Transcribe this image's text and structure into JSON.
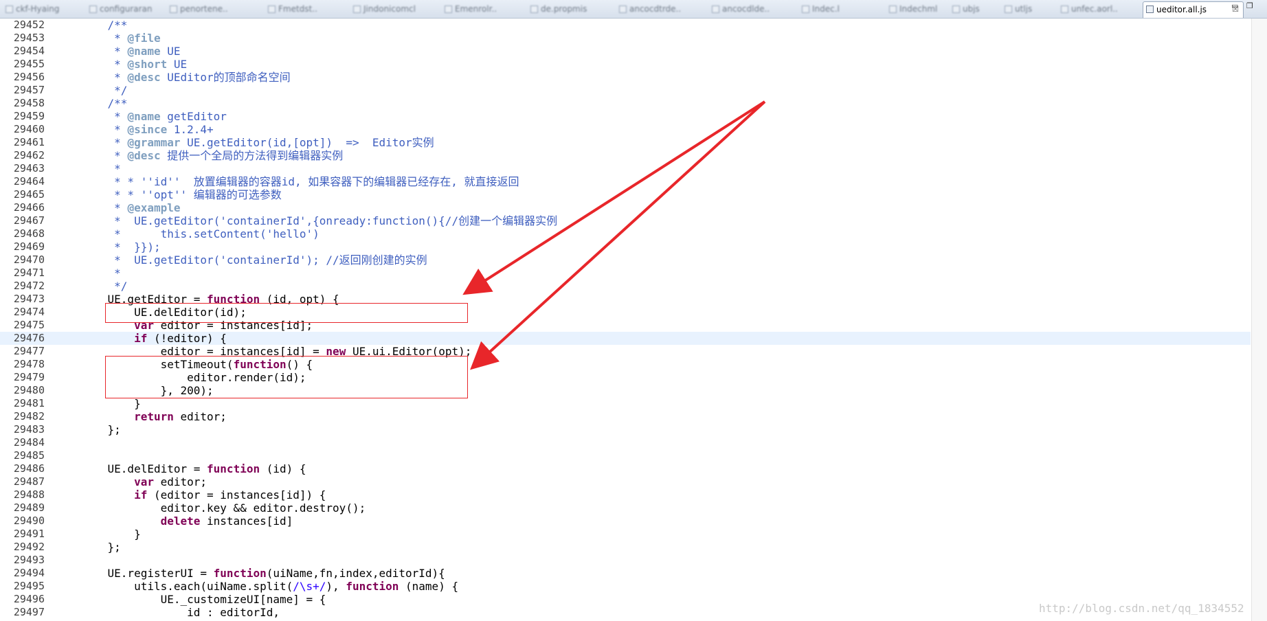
{
  "tabs": [
    {
      "label": "ckf-Hyaing"
    },
    {
      "label": "configuraran"
    },
    {
      "label": "penortene.."
    },
    {
      "label": "Fmetdst.."
    },
    {
      "label": "Jindonicomcl"
    },
    {
      "label": "Emenrolr.."
    },
    {
      "label": "de.propmis"
    },
    {
      "label": "ancocdtrde.."
    },
    {
      "label": "ancocdlde.."
    },
    {
      "label": "Indec.l"
    },
    {
      "label": "Indechml"
    },
    {
      "label": "ubjs"
    },
    {
      "label": "utljs"
    },
    {
      "label": "unfec.aorl.."
    },
    {
      "label": "ueditor.all.js",
      "active": true
    }
  ],
  "active_tab_close": "☒",
  "window_controls": {
    "minimize": "▭",
    "maximize": "❐"
  },
  "highlighted_line": "29476",
  "lines": [
    {
      "n": "29452",
      "segs": [
        {
          "t": "    /**",
          "c": "cm"
        }
      ]
    },
    {
      "n": "29453",
      "segs": [
        {
          "t": "     * ",
          "c": "cm"
        },
        {
          "t": "@file",
          "c": "tagc"
        }
      ]
    },
    {
      "n": "29454",
      "segs": [
        {
          "t": "     * ",
          "c": "cm"
        },
        {
          "t": "@name",
          "c": "tagc"
        },
        {
          "t": " UE",
          "c": "cm"
        }
      ]
    },
    {
      "n": "29455",
      "segs": [
        {
          "t": "     * ",
          "c": "cm"
        },
        {
          "t": "@short",
          "c": "tagc"
        },
        {
          "t": " UE",
          "c": "cm"
        }
      ]
    },
    {
      "n": "29456",
      "segs": [
        {
          "t": "     * ",
          "c": "cm"
        },
        {
          "t": "@desc",
          "c": "tagc"
        },
        {
          "t": " UEditor的顶部命名空间",
          "c": "cm"
        }
      ]
    },
    {
      "n": "29457",
      "segs": [
        {
          "t": "     */",
          "c": "cm"
        }
      ]
    },
    {
      "n": "29458",
      "segs": [
        {
          "t": "    /**",
          "c": "cm"
        }
      ]
    },
    {
      "n": "29459",
      "segs": [
        {
          "t": "     * ",
          "c": "cm"
        },
        {
          "t": "@name",
          "c": "tagc"
        },
        {
          "t": " getEditor",
          "c": "cm"
        }
      ]
    },
    {
      "n": "29460",
      "segs": [
        {
          "t": "     * ",
          "c": "cm"
        },
        {
          "t": "@since",
          "c": "tagc"
        },
        {
          "t": " 1.2.4+",
          "c": "cm"
        }
      ]
    },
    {
      "n": "29461",
      "segs": [
        {
          "t": "     * ",
          "c": "cm"
        },
        {
          "t": "@grammar",
          "c": "tagc"
        },
        {
          "t": " UE.getEditor(id,[opt])  =>  Editor实例",
          "c": "cm"
        }
      ]
    },
    {
      "n": "29462",
      "segs": [
        {
          "t": "     * ",
          "c": "cm"
        },
        {
          "t": "@desc",
          "c": "tagc"
        },
        {
          "t": " 提供一个全局的方法得到编辑器实例",
          "c": "cm"
        }
      ]
    },
    {
      "n": "29463",
      "segs": [
        {
          "t": "     *",
          "c": "cm"
        }
      ]
    },
    {
      "n": "29464",
      "segs": [
        {
          "t": "     * * ''id''  放置编辑器的容器id, 如果容器下的编辑器已经存在, 就直接返回",
          "c": "cm"
        }
      ]
    },
    {
      "n": "29465",
      "segs": [
        {
          "t": "     * * ''opt'' 编辑器的可选参数",
          "c": "cm"
        }
      ]
    },
    {
      "n": "29466",
      "segs": [
        {
          "t": "     * ",
          "c": "cm"
        },
        {
          "t": "@example",
          "c": "tagc"
        }
      ]
    },
    {
      "n": "29467",
      "segs": [
        {
          "t": "     *  UE.getEditor('containerId',{onready:function(){//创建一个编辑器实例",
          "c": "cm"
        }
      ]
    },
    {
      "n": "29468",
      "segs": [
        {
          "t": "     *      this.setContent('hello')",
          "c": "cm"
        }
      ]
    },
    {
      "n": "29469",
      "segs": [
        {
          "t": "     *  }});",
          "c": "cm"
        }
      ]
    },
    {
      "n": "29470",
      "segs": [
        {
          "t": "     *  UE.getEditor('containerId'); //返回刚创建的实例",
          "c": "cm"
        }
      ]
    },
    {
      "n": "29471",
      "segs": [
        {
          "t": "     *",
          "c": "cm"
        }
      ]
    },
    {
      "n": "29472",
      "segs": [
        {
          "t": "     */",
          "c": "cm"
        }
      ]
    },
    {
      "n": "29473",
      "segs": [
        {
          "t": "    UE.getEditor = ",
          "c": ""
        },
        {
          "t": "function",
          "c": "kw"
        },
        {
          "t": " (id, opt) {",
          "c": ""
        }
      ]
    },
    {
      "n": "29474",
      "segs": [
        {
          "t": "        UE.delEditor(id);",
          "c": ""
        }
      ]
    },
    {
      "n": "29475",
      "segs": [
        {
          "t": "        ",
          "c": ""
        },
        {
          "t": "var",
          "c": "kw"
        },
        {
          "t": " editor = instances[id];",
          "c": ""
        }
      ]
    },
    {
      "n": "29476",
      "segs": [
        {
          "t": "        ",
          "c": ""
        },
        {
          "t": "if",
          "c": "kw"
        },
        {
          "t": " (!editor) {",
          "c": ""
        }
      ]
    },
    {
      "n": "29477",
      "segs": [
        {
          "t": "            editor = instances[id] = ",
          "c": ""
        },
        {
          "t": "new",
          "c": "kw"
        },
        {
          "t": " UE.ui.Editor(opt);",
          "c": ""
        }
      ]
    },
    {
      "n": "29478",
      "segs": [
        {
          "t": "            setTimeout(",
          "c": ""
        },
        {
          "t": "function",
          "c": "kw"
        },
        {
          "t": "() {",
          "c": ""
        }
      ]
    },
    {
      "n": "29479",
      "segs": [
        {
          "t": "                editor.render(id);",
          "c": ""
        }
      ]
    },
    {
      "n": "29480",
      "segs": [
        {
          "t": "            }, 200);",
          "c": ""
        }
      ]
    },
    {
      "n": "29481",
      "segs": [
        {
          "t": "        }",
          "c": ""
        }
      ]
    },
    {
      "n": "29482",
      "segs": [
        {
          "t": "        ",
          "c": ""
        },
        {
          "t": "return",
          "c": "kw"
        },
        {
          "t": " editor;",
          "c": ""
        }
      ]
    },
    {
      "n": "29483",
      "segs": [
        {
          "t": "    };",
          "c": ""
        }
      ]
    },
    {
      "n": "29484",
      "segs": []
    },
    {
      "n": "29485",
      "segs": []
    },
    {
      "n": "29486",
      "segs": [
        {
          "t": "    UE.delEditor = ",
          "c": ""
        },
        {
          "t": "function",
          "c": "kw"
        },
        {
          "t": " (id) {",
          "c": ""
        }
      ]
    },
    {
      "n": "29487",
      "segs": [
        {
          "t": "        ",
          "c": ""
        },
        {
          "t": "var",
          "c": "kw"
        },
        {
          "t": " editor;",
          "c": ""
        }
      ]
    },
    {
      "n": "29488",
      "segs": [
        {
          "t": "        ",
          "c": ""
        },
        {
          "t": "if",
          "c": "kw"
        },
        {
          "t": " (editor = instances[id]) {",
          "c": ""
        }
      ]
    },
    {
      "n": "29489",
      "segs": [
        {
          "t": "            editor.key && editor.destroy();",
          "c": ""
        }
      ]
    },
    {
      "n": "29490",
      "segs": [
        {
          "t": "            ",
          "c": ""
        },
        {
          "t": "delete",
          "c": "kw"
        },
        {
          "t": " instances[id]",
          "c": ""
        }
      ]
    },
    {
      "n": "29491",
      "segs": [
        {
          "t": "        }",
          "c": ""
        }
      ]
    },
    {
      "n": "29492",
      "segs": [
        {
          "t": "    };",
          "c": ""
        }
      ]
    },
    {
      "n": "29493",
      "segs": []
    },
    {
      "n": "29494",
      "segs": [
        {
          "t": "    UE.registerUI = ",
          "c": ""
        },
        {
          "t": "function",
          "c": "kw"
        },
        {
          "t": "(uiName,fn,index,editorId){",
          "c": ""
        }
      ]
    },
    {
      "n": "29495",
      "segs": [
        {
          "t": "        utils.each(uiName.split(",
          "c": ""
        },
        {
          "t": "/\\s+/",
          "c": "rx"
        },
        {
          "t": "), ",
          "c": ""
        },
        {
          "t": "function",
          "c": "kw"
        },
        {
          "t": " (name) {",
          "c": ""
        }
      ]
    },
    {
      "n": "29496",
      "segs": [
        {
          "t": "            UE._customizeUI[name] = {",
          "c": ""
        }
      ]
    },
    {
      "n": "29497",
      "segs": [
        {
          "t": "                id : editorId,",
          "c": ""
        }
      ]
    }
  ],
  "annotation_colors": {
    "box": "#e8262a",
    "arrow": "#e8262a"
  },
  "watermark": "http://blog.csdn.net/qq_1834552"
}
